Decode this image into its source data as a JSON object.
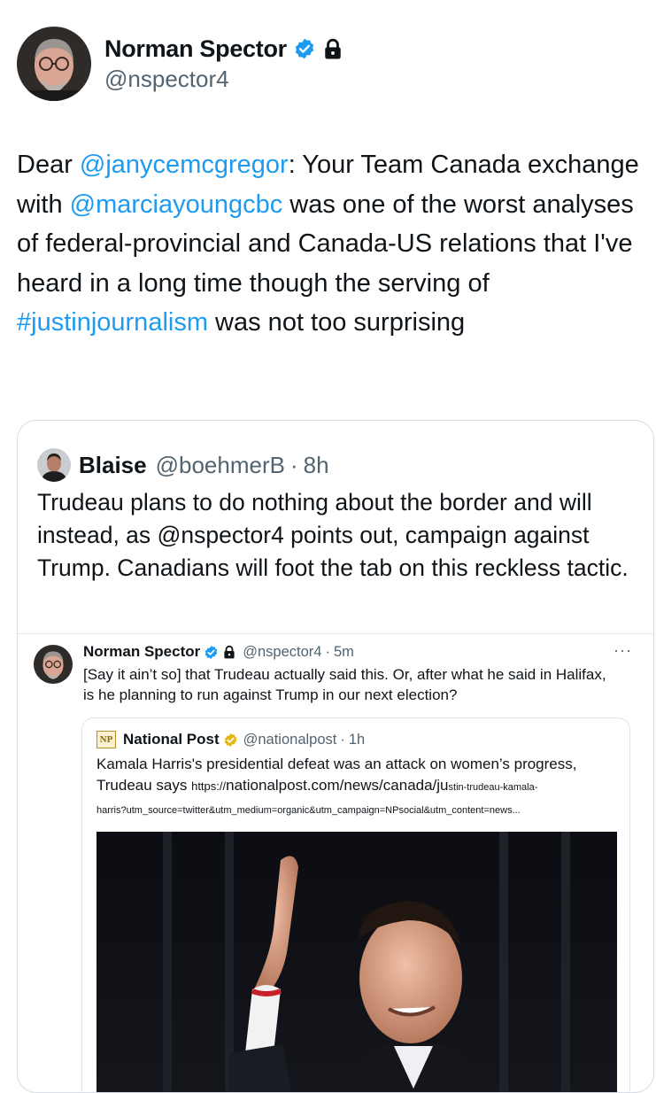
{
  "main_tweet": {
    "author_name": "Norman Spector",
    "handle": "@nspector4",
    "text_segments": [
      {
        "text": "Dear ",
        "link": false
      },
      {
        "text": "@janycemcgregor",
        "link": true
      },
      {
        "text": ": Your Team Canada exchange with ",
        "link": false
      },
      {
        "text": "@marciayoungcbc",
        "link": true
      },
      {
        "text": " was one of the worst analyses of federal-provincial and Canada-US relations that I've heard in a long time though the serving of ",
        "link": false
      },
      {
        "text": "#justinjournalism",
        "link": true
      },
      {
        "text": " was not too surprising",
        "link": false
      }
    ]
  },
  "quoted_tweet": {
    "author_name": "Blaise",
    "handle": "@boehmerB",
    "separator": "·",
    "time": "8h",
    "text": "Trudeau plans to do nothing about the border and will instead, as @nspector4 points out, campaign against Trump. Canadians will foot the tab on this reckless tactic."
  },
  "embedded_tweet": {
    "author_name": "Norman Spector",
    "handle": "@nspector4",
    "separator": "·",
    "time": "5m",
    "more": "···",
    "text": "[Say it ain’t so]  that Trudeau actually said this. Or, after what he said in Halifax, is he planning to run against Trump in our next election?"
  },
  "news_card": {
    "logo": "NP",
    "name": "National Post",
    "handle": "@nationalpost",
    "separator": "·",
    "time": "1h",
    "headline": "Kamala Harris's presidential defeat was an attack on women’s progress, Trudeau says ",
    "url_lead": "https://",
    "url_mid": "nationalpost.com/news/canada/ju",
    "url_tail": "stin-trudeau-kamala-",
    "url_line2": "harris?utm_source=twitter&utm_medium=organic&utm_campaign=NPsocial&utm_content=news..."
  },
  "colors": {
    "link": "#1d9bf0",
    "verified": "#1d9bf0",
    "secondary_text": "#536471",
    "business_badge": "#e2b719"
  },
  "icons": [
    "verified-badge-icon",
    "lock-icon",
    "more-icon",
    "gold-verified-badge-icon"
  ]
}
